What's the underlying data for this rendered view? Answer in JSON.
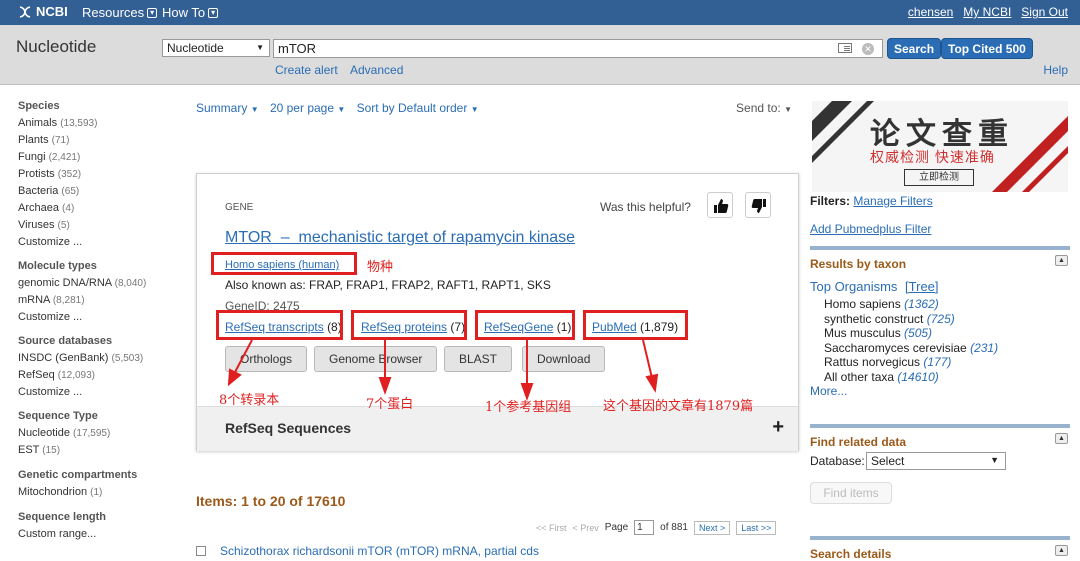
{
  "topbar": {
    "logo": "NCBI",
    "menu": [
      "Resources",
      "How To"
    ],
    "right_links": [
      "chensen",
      "My NCBI",
      "Sign Out"
    ]
  },
  "search": {
    "db_title": "Nucleotide",
    "db_select": "Nucleotide",
    "query": "mTOR",
    "search_btn": "Search",
    "top_cited_btn": "Top Cited 500",
    "create_alert": "Create alert",
    "advanced": "Advanced",
    "help": "Help"
  },
  "left_filters": [
    {
      "head": "Species",
      "items": [
        {
          "label": "Animals",
          "count": "(13,593)"
        },
        {
          "label": "Plants",
          "count": "(71)"
        },
        {
          "label": "Fungi",
          "count": "(2,421)"
        },
        {
          "label": "Protists",
          "count": "(352)"
        },
        {
          "label": "Bacteria",
          "count": "(65)"
        },
        {
          "label": "Archaea",
          "count": "(4)"
        },
        {
          "label": "Viruses",
          "count": "(5)"
        },
        {
          "label": "Customize ...",
          "count": ""
        }
      ]
    },
    {
      "head": "Molecule types",
      "items": [
        {
          "label": "genomic DNA/RNA",
          "count": "(8,040)"
        },
        {
          "label": "mRNA",
          "count": "(8,281)"
        },
        {
          "label": "Customize ...",
          "count": ""
        }
      ]
    },
    {
      "head": "Source databases",
      "items": [
        {
          "label": "INSDC (GenBank)",
          "count": "(5,503)"
        },
        {
          "label": "RefSeq",
          "count": "(12,093)"
        },
        {
          "label": "Customize ...",
          "count": ""
        }
      ]
    },
    {
      "head": "Sequence Type",
      "items": [
        {
          "label": "Nucleotide",
          "count": "(17,595)"
        },
        {
          "label": "EST",
          "count": "(15)"
        }
      ]
    },
    {
      "head": "Genetic compartments",
      "items": [
        {
          "label": "Mitochondrion",
          "count": "(1)"
        }
      ]
    },
    {
      "head": "Sequence length",
      "items": [
        {
          "label": "Custom range...",
          "count": ""
        }
      ]
    }
  ],
  "toolbar": {
    "summary": "Summary",
    "per_page": "20 per page",
    "sort": "Sort by Default order",
    "send_to": "Send to:"
  },
  "gene": {
    "label": "GENE",
    "helpful": "Was this helpful?",
    "title": "MTOR  –  mechanistic target of rapamycin kinase",
    "species": "Homo sapiens (human)",
    "aka": "Also known as: FRAP, FRAP1, FRAP2, RAFT1, RAPT1, SKS",
    "gene_id": "GeneID: 2475",
    "links": [
      {
        "label": "RefSeq transcripts",
        "count": "(8)"
      },
      {
        "label": "RefSeq proteins",
        "count": "(7)"
      },
      {
        "label": "RefSeqGene",
        "count": "(1)"
      },
      {
        "label": "PubMed",
        "count": "(1,879)"
      }
    ],
    "buttons": [
      "Orthologs",
      "Genome Browser",
      "BLAST",
      "Download"
    ],
    "refseq_title": "RefSeq Sequences",
    "refseq_plus": "+"
  },
  "annotations": {
    "species": "物种",
    "transcripts": "8个转录本",
    "proteins": "7个蛋白",
    "refseqgene": "1个参考基因组",
    "pubmed": "这个基因的文章有1879篇"
  },
  "results": {
    "items": "Items: 1 to 20 of 17610",
    "first": "<< First",
    "prev": "< Prev",
    "page_label": "Page",
    "page_value": "1",
    "of": "of 881",
    "next": "Next >",
    "last": "Last >>",
    "first_result": "Schizothorax richardsonii mTOR (mTOR) mRNA, partial cds"
  },
  "ad": {
    "big": "论文查重",
    "small": "权威检测 快速准确",
    "btn": "立即检测"
  },
  "right": {
    "filters_label": "Filters:",
    "manage_filters": "Manage Filters",
    "add_pubmedplus": "Add Pubmedplus Filter",
    "taxon_head": "Results by taxon",
    "top_organisms": "Top Organisms",
    "tree": "[Tree]",
    "taxa": [
      {
        "name": "Homo sapiens",
        "count": "(1362)"
      },
      {
        "name": "synthetic construct",
        "count": "(725)"
      },
      {
        "name": "Mus musculus",
        "count": "(505)"
      },
      {
        "name": "Saccharomyces cerevisiae",
        "count": "(231)"
      },
      {
        "name": "Rattus norvegicus",
        "count": "(177)"
      },
      {
        "name": "All other taxa",
        "count": "(14610)"
      }
    ],
    "more": "More...",
    "related_head": "Find related data",
    "database_label": "Database:",
    "database_value": "Select",
    "find_items": "Find items",
    "search_details_head": "Search details"
  },
  "colors": {
    "ncbi_blue": "#325f94",
    "link": "#2a6db5",
    "annotation_red": "#e02020",
    "section_brown": "#9c5a1a"
  }
}
